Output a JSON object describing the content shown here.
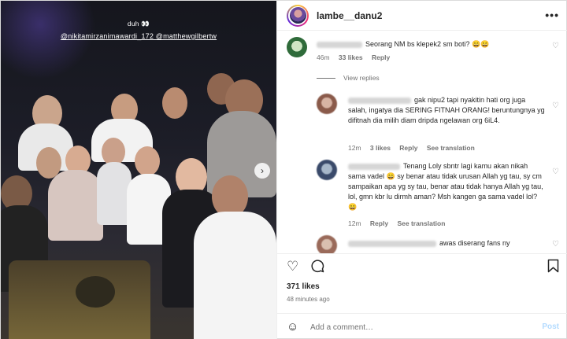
{
  "photo": {
    "overlay_caption": "duh 👀",
    "overlay_tags": "@nikitamirzanimawardi_172 @matthewgilbertw",
    "next_icon": "chevron-right-icon"
  },
  "header": {
    "username": "lambe__danu2",
    "more_icon": "more-horizontal-icon",
    "more_label": "•••"
  },
  "comments": [
    {
      "text": "Seorang NM bs klepek2 sm boti? 😄😄",
      "time": "46m",
      "likes": "33 likes",
      "reply": "Reply"
    },
    {
      "text": "gak nipu2 tapi nyakitin hati org juga salah, ingatya dia SERING FITNAH ORANG! beruntungnya yg difitnah dia milih diam dripda ngelawan org 6iL4.",
      "time": "12m",
      "likes": "3 likes",
      "reply": "Reply",
      "translation": "See translation"
    },
    {
      "text": "Tenang Loly sbntr lagi kamu akan nikah sama vadel 😄 sy benar atau tidak urusan Allah yg tau, sy cm sampaikan apa yg sy tau, benar atau tidak hanya Allah yg tau, lol, gmn kbr lu dirmh aman? Msh kangen ga sama vadel lol? 😄",
      "time": "12m",
      "reply": "Reply",
      "translation": "See translation"
    },
    {
      "text": "awas diserang fans ny"
    }
  ],
  "view_replies": "View replies",
  "actions": {
    "like_icon": "heart-icon",
    "comment_icon": "comment-icon",
    "bookmark_icon": "bookmark-icon"
  },
  "likes": "371 likes",
  "posted": "48 minutes ago",
  "add_comment": {
    "placeholder": "Add a comment…",
    "post_label": "Post",
    "emoji_icon": "emoji-smile-icon"
  },
  "colors": {
    "link": "#0095f6",
    "post_disabled": "#b3dbff",
    "muted": "#737373",
    "border": "#efefef"
  }
}
